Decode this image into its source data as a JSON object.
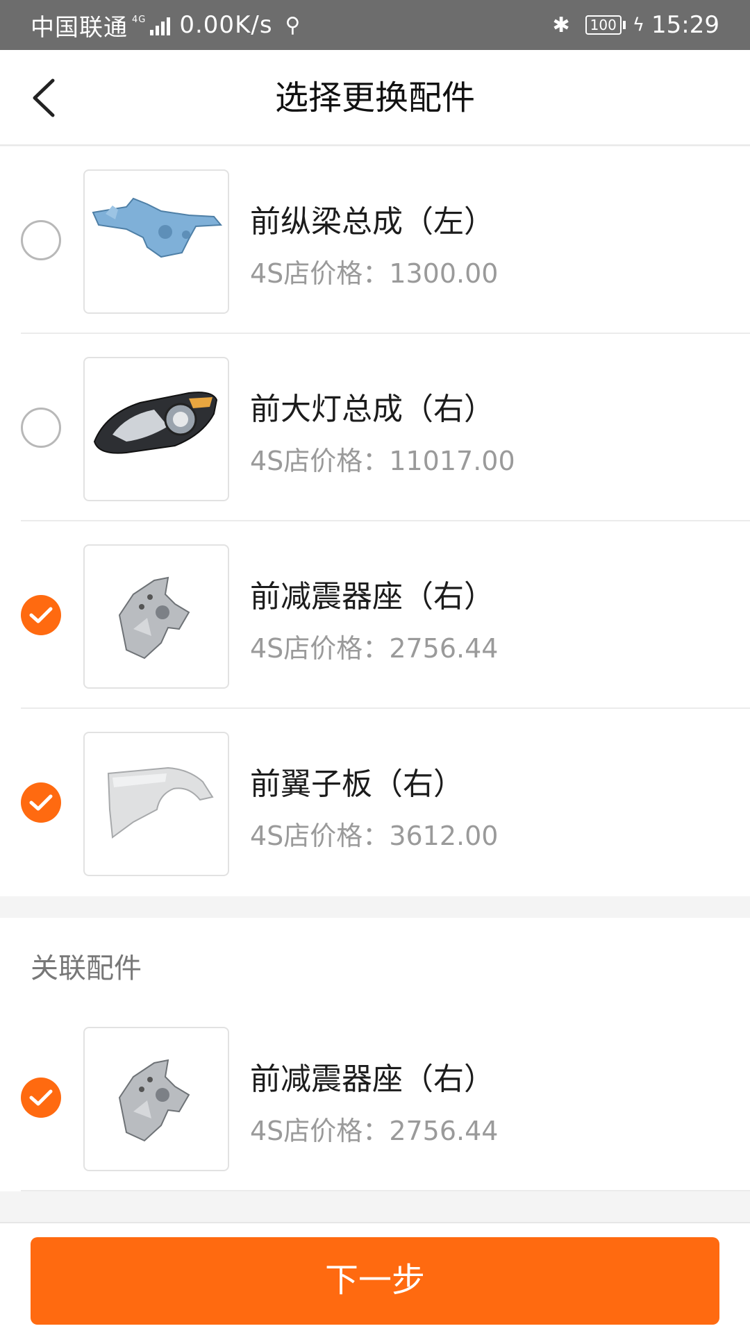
{
  "status_bar": {
    "carrier": "中国联通",
    "network": "4G",
    "speed": "0.00K/s",
    "battery": "100",
    "time": "15:29",
    "icons": [
      "signal-icon",
      "usb-icon",
      "bluetooth-icon",
      "battery-icon",
      "charging-icon"
    ]
  },
  "header": {
    "title": "选择更换配件",
    "back_icon": "chevron-left-icon"
  },
  "parts": [
    {
      "name": "前纵梁总成（左）",
      "price_label": "4S店价格：",
      "price": "1300.00",
      "selected": false,
      "image": "front-rail-image"
    },
    {
      "name": "前大灯总成（右）",
      "price_label": "4S店价格：",
      "price": "11017.00",
      "selected": false,
      "image": "headlight-image"
    },
    {
      "name": "前减震器座（右）",
      "price_label": "4S店价格：",
      "price": "2756.44",
      "selected": true,
      "image": "shock-mount-image"
    },
    {
      "name": "前翼子板（右）",
      "price_label": "4S店价格：",
      "price": "3612.00",
      "selected": true,
      "image": "fender-image"
    }
  ],
  "related": {
    "title": "关联配件",
    "items": [
      {
        "name": "前减震器座（右）",
        "price_label": "4S店价格：",
        "price": "2756.44",
        "selected": true,
        "image": "shock-mount-image"
      }
    ]
  },
  "footer": {
    "next_label": "下一步"
  },
  "colors": {
    "accent": "#ff6a10",
    "status_bar": "#6d6d6d",
    "price_text": "#9a9a9a",
    "background": "#f4f4f4"
  }
}
